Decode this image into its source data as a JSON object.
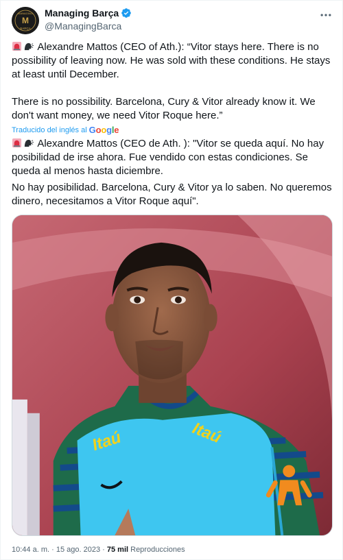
{
  "account": {
    "display_name": "Managing Barça",
    "handle": "@ManagingBarca",
    "avatar_lines": [
      "MANAGING",
      "M",
      "BARÇA"
    ]
  },
  "tweet": {
    "english_p1": "Alexandre Mattos (CEO of Ath.): “Vitor stays here. There is no possibility of leaving now. He was sold with these conditions. He stays at least until December.",
    "english_p2": "There is no possibility. Barcelona, Cury & Vitor already know it. We don't want money, we need Vitor Roque here.”",
    "translated_label": "Traducido del inglés al",
    "translator_brand": "Google",
    "spanish_p1": "Alexandre Mattos (CEO de Ath. ): \"Vitor se queda aquí. No hay posibilidad de irse ahora. Fue vendido con estas condiciones. Se queda al menos hasta diciembre.",
    "spanish_p2": "No hay posibilidad. Barcelona, Cury & Vitor ya lo saben. No queremos dinero, necesitamos a Vitor Roque aquí\".",
    "emojis": [
      "siren-icon",
      "speaking-head-icon"
    ]
  },
  "photo": {
    "bib_text_left": "Itaú",
    "bib_text_right": "Itaú"
  },
  "meta": {
    "time": "10:44 a. m.",
    "separator": "·",
    "date": "15 ago. 2023",
    "views_count": "75 mil",
    "views_label": "Reproducciones"
  },
  "colors": {
    "verified_blue": "#1d9bf0",
    "link_blue": "#1d9bf0",
    "secondary_text": "#536471"
  }
}
